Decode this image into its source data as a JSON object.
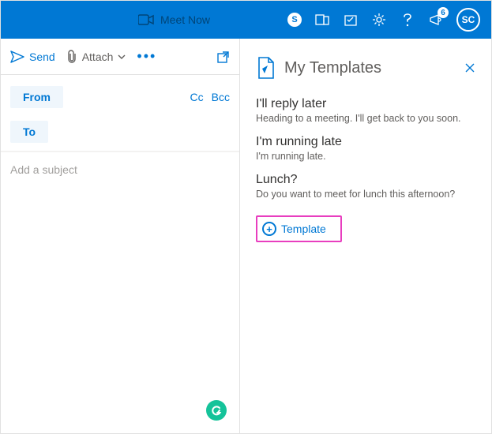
{
  "topbar": {
    "meet_now": "Meet Now",
    "skype_letter": "S",
    "notification_count": "6",
    "avatar_initials": "SC"
  },
  "toolbar": {
    "send_label": "Send",
    "attach_label": "Attach"
  },
  "compose": {
    "from_label": "From",
    "to_label": "To",
    "cc_label": "Cc",
    "bcc_label": "Bcc",
    "subject_placeholder": "Add a subject"
  },
  "panel": {
    "title": "My Templates",
    "templates": [
      {
        "title": "I'll reply later",
        "preview": "Heading to a meeting. I'll get back to you soon."
      },
      {
        "title": "I'm running late",
        "preview": "I'm running late."
      },
      {
        "title": "Lunch?",
        "preview": "Do you want to meet for lunch this afternoon?"
      }
    ],
    "add_label": "Template"
  }
}
